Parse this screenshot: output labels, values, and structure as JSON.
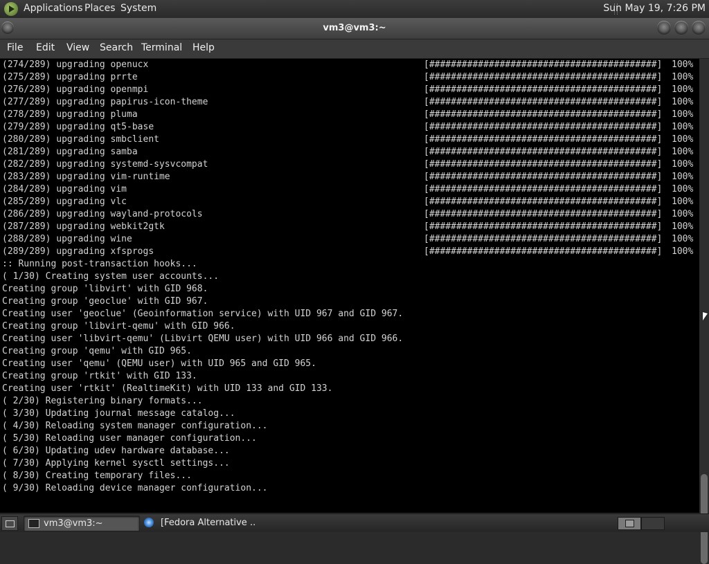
{
  "top_panel": {
    "menu": [
      "Applications",
      "Places",
      "System"
    ],
    "clock": "Sun May 19,  7:26 PM"
  },
  "window": {
    "title": "vm3@vm3:~"
  },
  "menubar": [
    "File",
    "Edit",
    "View",
    "Search",
    "Terminal",
    "Help"
  ],
  "terminal": {
    "progress_lines": [
      {
        "text": "(274/289) upgrading openucx",
        "bar": "[##########################################]",
        "pct": "100%"
      },
      {
        "text": "(275/289) upgrading prrte",
        "bar": "[##########################################]",
        "pct": "100%"
      },
      {
        "text": "(276/289) upgrading openmpi",
        "bar": "[##########################################]",
        "pct": "100%"
      },
      {
        "text": "(277/289) upgrading papirus-icon-theme",
        "bar": "[##########################################]",
        "pct": "100%"
      },
      {
        "text": "(278/289) upgrading pluma",
        "bar": "[##########################################]",
        "pct": "100%"
      },
      {
        "text": "(279/289) upgrading qt5-base",
        "bar": "[##########################################]",
        "pct": "100%"
      },
      {
        "text": "(280/289) upgrading smbclient",
        "bar": "[##########################################]",
        "pct": "100%"
      },
      {
        "text": "(281/289) upgrading samba",
        "bar": "[##########################################]",
        "pct": "100%"
      },
      {
        "text": "(282/289) upgrading systemd-sysvcompat",
        "bar": "[##########################################]",
        "pct": "100%"
      },
      {
        "text": "(283/289) upgrading vim-runtime",
        "bar": "[##########################################]",
        "pct": "100%"
      },
      {
        "text": "(284/289) upgrading vim",
        "bar": "[##########################################]",
        "pct": "100%"
      },
      {
        "text": "(285/289) upgrading vlc",
        "bar": "[##########################################]",
        "pct": "100%"
      },
      {
        "text": "(286/289) upgrading wayland-protocols",
        "bar": "[##########################################]",
        "pct": "100%"
      },
      {
        "text": "(287/289) upgrading webkit2gtk",
        "bar": "[##########################################]",
        "pct": "100%"
      },
      {
        "text": "(288/289) upgrading wine",
        "bar": "[##########################################]",
        "pct": "100%"
      },
      {
        "text": "(289/289) upgrading xfsprogs",
        "bar": "[##########################################]",
        "pct": "100%"
      }
    ],
    "lines": [
      ":: Running post-transaction hooks...",
      "( 1/30) Creating system user accounts...",
      "Creating group 'libvirt' with GID 968.",
      "Creating group 'geoclue' with GID 967.",
      "Creating user 'geoclue' (Geoinformation service) with UID 967 and GID 967.",
      "Creating group 'libvirt-qemu' with GID 966.",
      "Creating user 'libvirt-qemu' (Libvirt QEMU user) with UID 966 and GID 966.",
      "Creating group 'qemu' with GID 965.",
      "Creating user 'qemu' (QEMU user) with UID 965 and GID 965.",
      "Creating group 'rtkit' with GID 133.",
      "Creating user 'rtkit' (RealtimeKit) with UID 133 and GID 133.",
      "( 2/30) Registering binary formats...",
      "( 3/30) Updating journal message catalog...",
      "( 4/30) Reloading system manager configuration...",
      "( 5/30) Reloading user manager configuration...",
      "( 6/30) Updating udev hardware database...",
      "( 7/30) Applying kernel sysctl settings...",
      "( 8/30) Creating temporary files...",
      "( 9/30) Reloading device manager configuration..."
    ]
  },
  "taskbar": {
    "tasks": [
      "vm3@vm3:~",
      "[Fedora Alternative ..."
    ]
  },
  "colors": {
    "terminal_bg": "#000000",
    "terminal_fg": "#d3d3d3",
    "panel": "#2b2b2b"
  }
}
